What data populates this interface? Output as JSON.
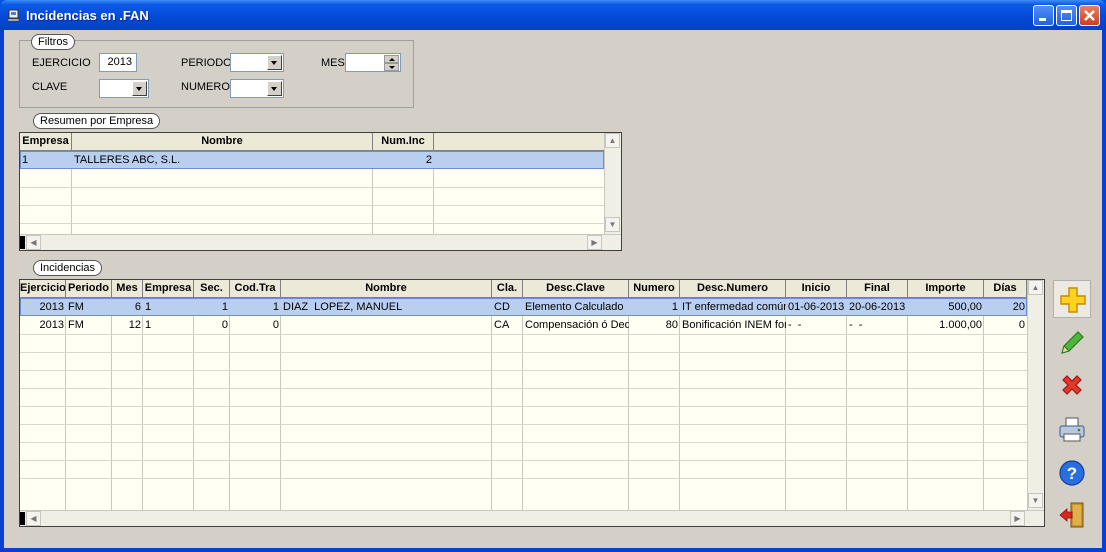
{
  "window": {
    "title": "Incidencias en .FAN"
  },
  "filters": {
    "legend": "Filtros",
    "ejercicio_label": "EJERCICIO",
    "ejercicio_value": "2013",
    "periodo_label": "PERIODO",
    "periodo_value": "",
    "mes_label": "MES",
    "mes_value": "",
    "clave_label": "CLAVE",
    "clave_value": "",
    "numero_label": "NUMERO",
    "numero_value": ""
  },
  "summary": {
    "legend": "Resumen por Empresa",
    "columns": [
      "Empresa",
      "Nombre",
      "Num.Inc"
    ],
    "rows": [
      {
        "empresa": "1",
        "nombre": "TALLERES ABC, S.L.",
        "num_inc": "2"
      }
    ]
  },
  "incidencias": {
    "legend": "Incidencias",
    "columns": [
      "Ejercicio",
      "Periodo",
      "Mes",
      "Empresa",
      "Sec.",
      "Cod.Tra",
      "Nombre",
      "Cla.",
      "Desc.Clave",
      "Numero",
      "Desc.Numero",
      "Inicio",
      "Final",
      "Importe",
      "Días"
    ],
    "rows": [
      {
        "ejercicio": "2013",
        "periodo": "FM",
        "mes": "6",
        "empresa": "1",
        "sec": "1",
        "cod_tra": "1",
        "nombre": "DIAZ  LOPEZ, MANUEL",
        "cla": "CD",
        "desc_clave": "Elemento Calculado",
        "numero": "1",
        "desc_numero": "IT enfermedad común",
        "inicio": "01-06-2013",
        "final": "20-06-2013",
        "importe": "500,00",
        "dias": "20"
      },
      {
        "ejercicio": "2013",
        "periodo": "FM",
        "mes": "12",
        "empresa": "1",
        "sec": "0",
        "cod_tra": "0",
        "nombre": "",
        "cla": "CA",
        "desc_clave": "Compensación ó Dedu",
        "numero": "80",
        "desc_numero": "Bonificación INEM form",
        "inicio": "-  -",
        "final": "-  -",
        "importe": "1.000,00",
        "dias": "0"
      }
    ]
  },
  "toolbar": {
    "icons": [
      "add-icon",
      "edit-pencil-icon",
      "delete-icon",
      "printer-icon",
      "help-icon",
      "exit-door-icon"
    ]
  },
  "colors": {
    "title_bar": "#0549d6",
    "client_bg": "#d4d0c8",
    "grid_bg": "#fffff4",
    "selected_row": "#b9cff0"
  }
}
